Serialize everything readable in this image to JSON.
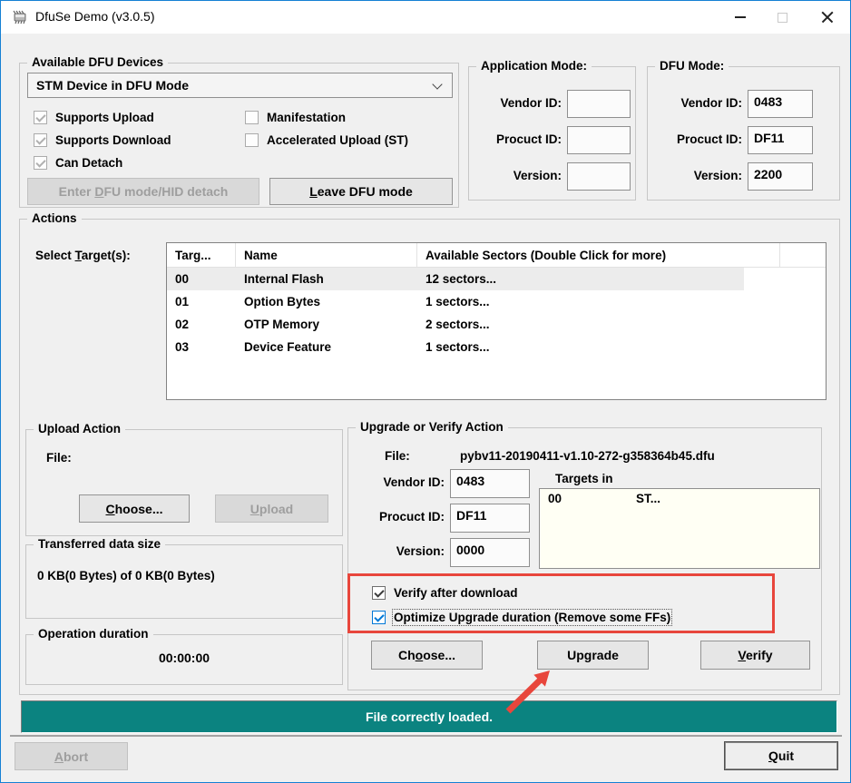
{
  "window": {
    "title": "DfuSe Demo (v3.0.5)",
    "icons": {
      "app": "chip-icon",
      "minimize": "minimize-icon",
      "maximize": "maximize-icon",
      "close": "close-icon"
    }
  },
  "available": {
    "label": "Available DFU Devices",
    "combo_value": "STM Device in DFU Mode",
    "checks_left": [
      {
        "label": "Supports Upload",
        "checked": true,
        "disabled": true
      },
      {
        "label": "Supports Download",
        "checked": true,
        "disabled": true
      },
      {
        "label": "Can Detach",
        "checked": true,
        "disabled": true
      }
    ],
    "checks_right": [
      {
        "label": "Manifestation",
        "checked": false,
        "disabled": true
      },
      {
        "label": "Accelerated Upload (ST)",
        "checked": false,
        "disabled": true
      }
    ],
    "enter_btn": {
      "pre": "Enter ",
      "key": "D",
      "post": "FU mode/HID detach",
      "disabled": true
    },
    "leave_btn": {
      "pre": "",
      "key": "L",
      "post": "eave DFU mode",
      "disabled": false
    }
  },
  "app_mode": {
    "label": "Application Mode:",
    "vendor_label": "Vendor ID:",
    "vendor": "",
    "product_label": "Procuct ID:",
    "product": "",
    "version_label": "Version:",
    "version": ""
  },
  "dfu_mode": {
    "label": "DFU Mode:",
    "vendor_label": "Vendor ID:",
    "vendor": "0483",
    "product_label": "Procuct ID:",
    "product": "DF11",
    "version_label": "Version:",
    "version": "2200"
  },
  "actions": {
    "label": "Actions",
    "select_target": {
      "pre": "Select ",
      "key": "T",
      "post": "arget(s):"
    },
    "table": {
      "headers": [
        "Targ...",
        "Name",
        "Available Sectors (Double Click for more)"
      ],
      "rows": [
        {
          "target": "00",
          "name": "Internal Flash",
          "sectors": "12 sectors...",
          "selected": true
        },
        {
          "target": "01",
          "name": "Option Bytes",
          "sectors": "1 sectors...",
          "selected": false
        },
        {
          "target": "02",
          "name": "OTP Memory",
          "sectors": "2 sectors...",
          "selected": false
        },
        {
          "target": "03",
          "name": "Device Feature",
          "sectors": "1 sectors...",
          "selected": false
        }
      ]
    }
  },
  "upload": {
    "label": "Upload Action",
    "file_label": "File:",
    "choose_btn": {
      "pre": "",
      "key": "C",
      "post": "hoose..."
    },
    "upload_btn": {
      "pre": "",
      "key": "U",
      "post": "pload",
      "disabled": true
    }
  },
  "transferred": {
    "label": "Transferred data size",
    "value": "0 KB(0 Bytes) of 0 KB(0 Bytes)"
  },
  "duration": {
    "label": "Operation duration",
    "value": "00:00:00"
  },
  "upgrade": {
    "label": "Upgrade or Verify Action",
    "file_label": "File:",
    "file_name": "pybv11-20190411-v1.10-272-g358364b45.dfu",
    "vendor_label": "Vendor ID:",
    "vendor": "0483",
    "product_label": "Procuct ID:",
    "product": "DF11",
    "version_label": "Version:",
    "version": "0000",
    "targets_label": "Targets in",
    "targets_row": {
      "id": "00",
      "name": "ST..."
    },
    "verify_check": "Verify after download",
    "optimize_check": "Optimize Upgrade duration (Remove some FFs)",
    "choose_btn": {
      "pre": "Ch",
      "key": "o",
      "post": "ose..."
    },
    "upgrade_btn": {
      "pre": "Up",
      "key": "g",
      "post": "rade"
    },
    "verify_btn": {
      "pre": "",
      "key": "V",
      "post": "erify"
    }
  },
  "status": {
    "message": "File correctly loaded."
  },
  "footer": {
    "abort_btn": {
      "pre": "",
      "key": "A",
      "post": "bort",
      "disabled": true
    },
    "quit_btn": {
      "pre": "",
      "key": "Q",
      "post": "uit",
      "disabled": false
    }
  },
  "colors": {
    "accent_blue": "#0078d7",
    "status_teal": "#0b8380",
    "annotation_red": "#e8463c",
    "listbox_ivory": "#fffff4",
    "selected_row": "#ececec"
  }
}
